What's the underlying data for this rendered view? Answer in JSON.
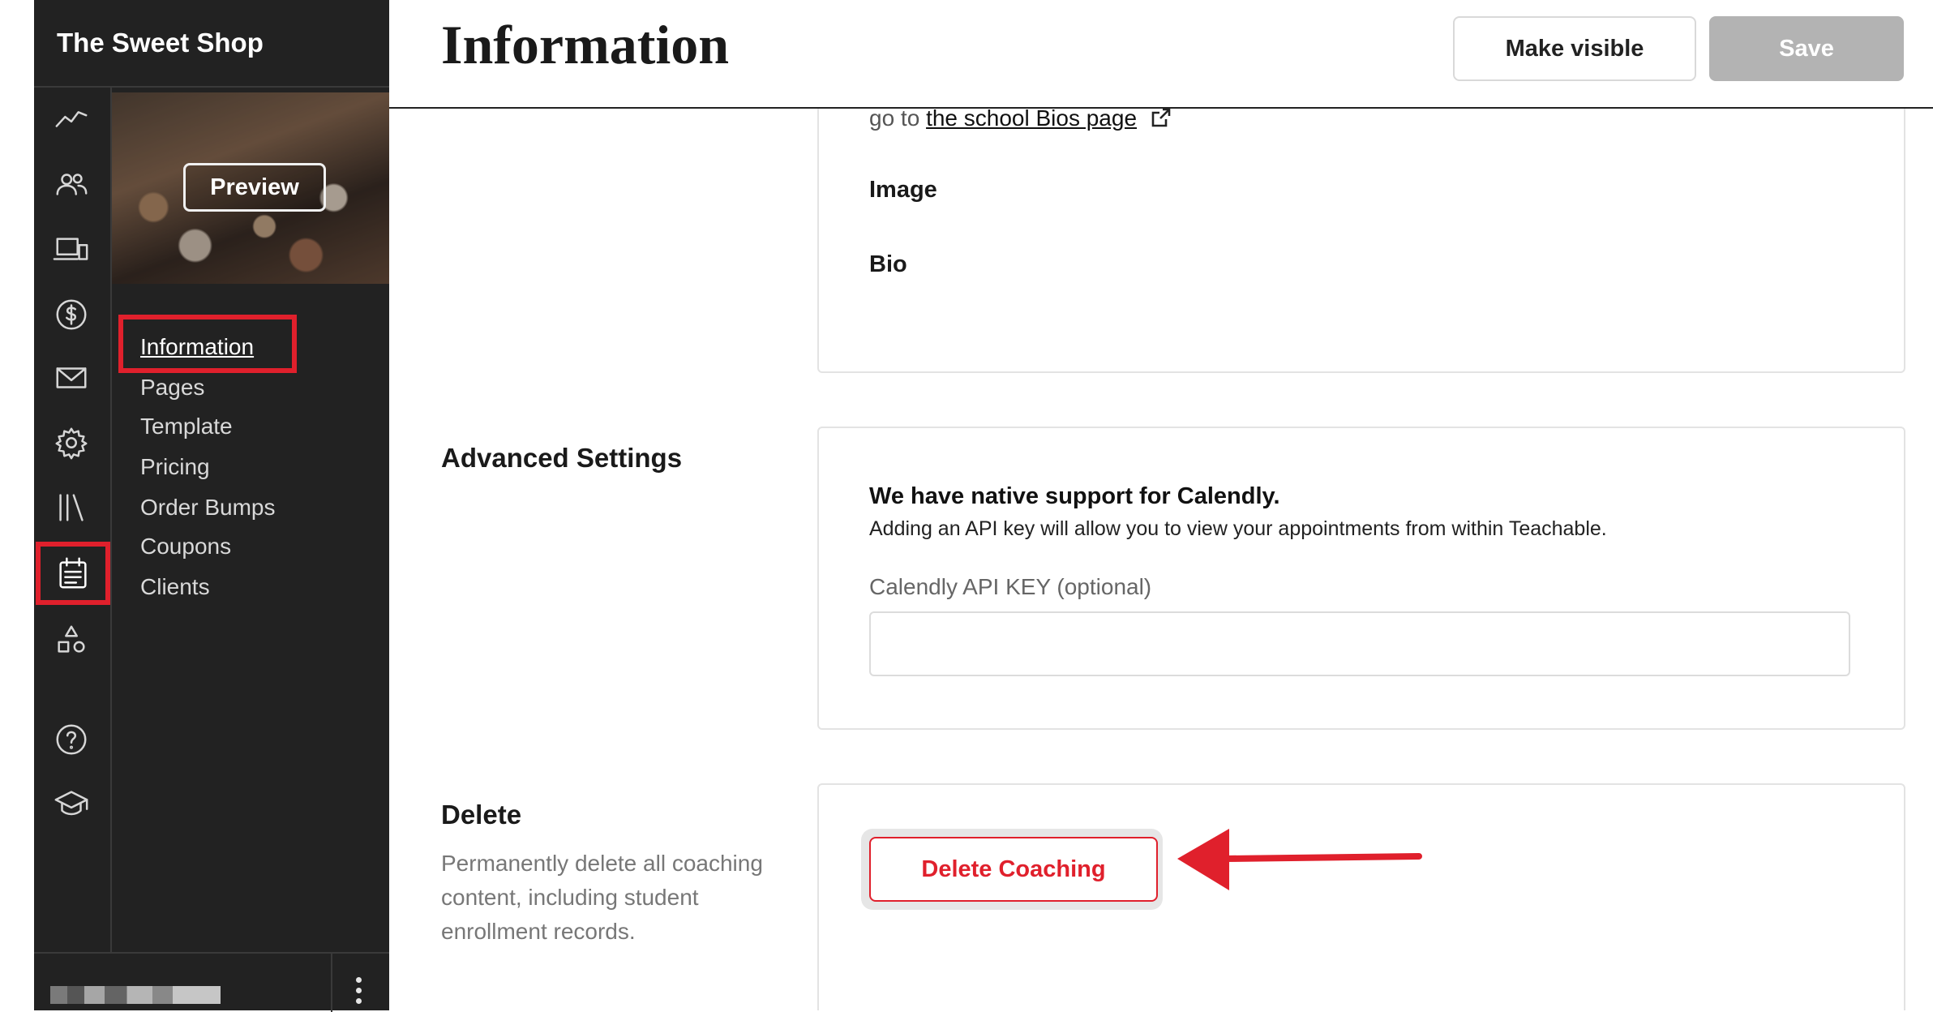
{
  "app": {
    "school_name": "The Sweet Shop"
  },
  "header": {
    "title": "Information",
    "make_visible_label": "Make visible",
    "save_label": "Save"
  },
  "sidebar": {
    "rail_icons": [
      "analytics-icon",
      "users-icon",
      "devices-icon",
      "dollar-icon",
      "mail-icon",
      "gear-icon",
      "library-icon",
      "calendar-icon",
      "shapes-icon",
      "help-icon",
      "graduation-cap-icon"
    ],
    "active_rail_icon": "calendar-icon",
    "preview_label": "Preview",
    "nav_items": [
      {
        "label": "Information",
        "active": true
      },
      {
        "label": "Pages",
        "active": false
      },
      {
        "label": "Template",
        "active": false
      },
      {
        "label": "Pricing",
        "active": false
      },
      {
        "label": "Order Bumps",
        "active": false
      },
      {
        "label": "Coupons",
        "active": false
      },
      {
        "label": "Clients",
        "active": false
      }
    ]
  },
  "bio_section": {
    "note_prefix": "go to",
    "link_text": "the school Bios page",
    "image_label": "Image",
    "bio_label": "Bio"
  },
  "advanced": {
    "title": "Advanced Settings",
    "heading": "We have native support for Calendly.",
    "subtext": "Adding an API key will allow you to view your appointments from within Teachable.",
    "api_label": "Calendly API KEY (optional)",
    "api_value": ""
  },
  "delete": {
    "title": "Delete",
    "description": "Permanently delete all coaching content, including student enrollment records.",
    "button_label": "Delete Coaching"
  },
  "colors": {
    "sidebar_bg": "#222222",
    "highlight": "#e0202c",
    "save_disabled": "#b3b3b3"
  }
}
